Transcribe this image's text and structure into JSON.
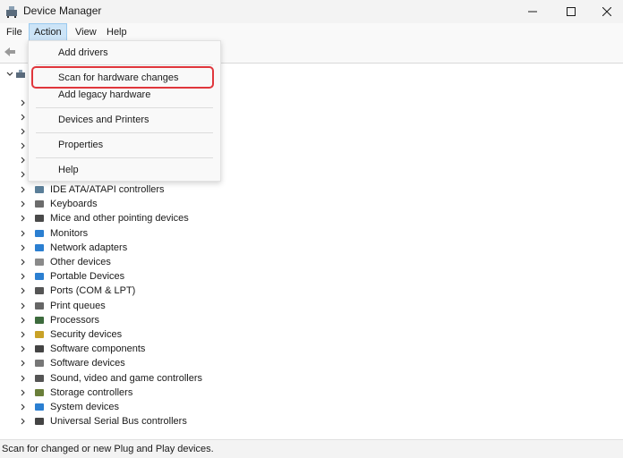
{
  "window": {
    "title": "Device Manager",
    "controls": [
      "minimize",
      "maximize",
      "close"
    ]
  },
  "menubar": {
    "items": [
      {
        "label": "File"
      },
      {
        "label": "Action"
      },
      {
        "label": "View"
      },
      {
        "label": "Help"
      }
    ]
  },
  "action_menu": {
    "items": [
      {
        "label": "Add drivers"
      },
      {
        "label": "Scan for hardware changes",
        "highlighted": true
      },
      {
        "label": "Add legacy hardware"
      },
      {
        "label": "Devices and Printers"
      },
      {
        "label": "Properties"
      },
      {
        "label": "Help"
      }
    ],
    "highlight_color": "#e0363c"
  },
  "tree": {
    "categories": [
      {
        "label": "IDE ATA/ATAPI controllers",
        "icon": "ide-controller-icon"
      },
      {
        "label": "Keyboards",
        "icon": "keyboard-icon"
      },
      {
        "label": "Mice and other pointing devices",
        "icon": "mouse-icon"
      },
      {
        "label": "Monitors",
        "icon": "monitor-icon"
      },
      {
        "label": "Network adapters",
        "icon": "network-adapter-icon"
      },
      {
        "label": "Other devices",
        "icon": "unknown-device-icon"
      },
      {
        "label": "Portable Devices",
        "icon": "portable-device-icon"
      },
      {
        "label": "Ports (COM & LPT)",
        "icon": "port-icon"
      },
      {
        "label": "Print queues",
        "icon": "printer-icon"
      },
      {
        "label": "Processors",
        "icon": "processor-icon"
      },
      {
        "label": "Security devices",
        "icon": "security-device-icon"
      },
      {
        "label": "Software components",
        "icon": "software-component-icon"
      },
      {
        "label": "Software devices",
        "icon": "software-device-icon"
      },
      {
        "label": "Sound, video and game controllers",
        "icon": "speaker-icon"
      },
      {
        "label": "Storage controllers",
        "icon": "storage-controller-icon"
      },
      {
        "label": "System devices",
        "icon": "system-device-icon"
      },
      {
        "label": "Universal Serial Bus controllers",
        "icon": "usb-icon"
      }
    ]
  },
  "statusbar": {
    "text": "Scan for changed or new Plug and Play devices."
  }
}
